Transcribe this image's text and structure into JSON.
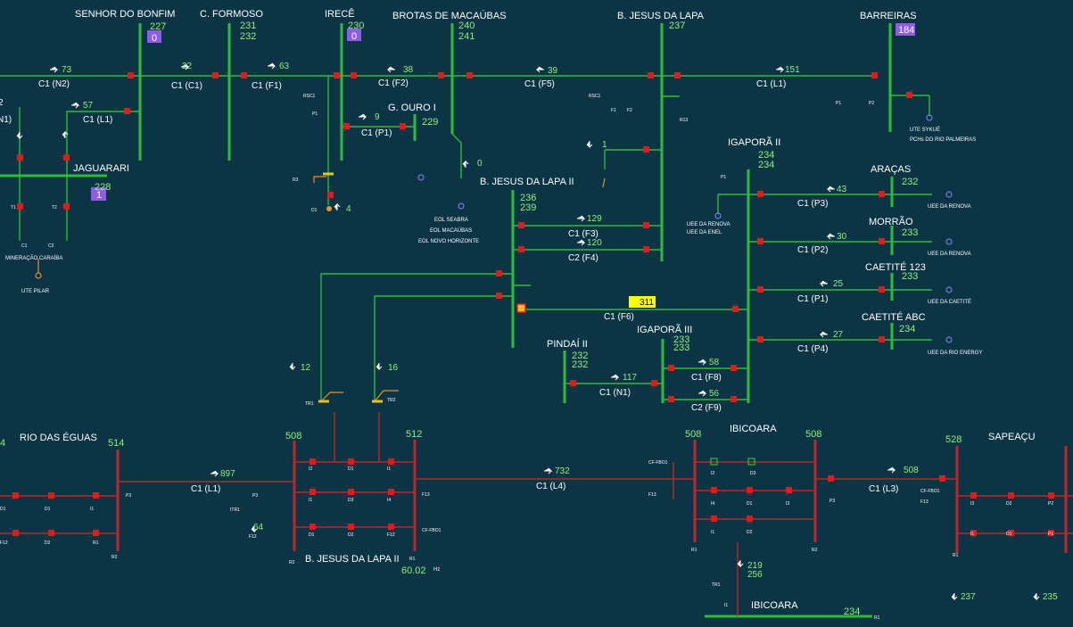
{
  "colors": {
    "background": "#0b3445",
    "bus_230": "#2fbb3a",
    "bus_500": "#c3232a",
    "breaker": "#e01b1b",
    "flow": "#8ff27a",
    "alarm": "#ffff00",
    "tag": "#8f5ce8"
  },
  "substations": {
    "senhor_do_bonfim": {
      "name": "SENHOR DO BONFIM",
      "kv": "227",
      "tag": "0"
    },
    "c_formoso": {
      "name": "C. FORMOSO",
      "kv1": "231",
      "kv2": "232"
    },
    "irece": {
      "name": "IRECÊ",
      "kv": "230",
      "tag": "0"
    },
    "brotas": {
      "name": "BROTAS DE MACAÚBAS",
      "kv1": "240",
      "kv2": "241"
    },
    "bjl": {
      "name": "B. JESUS DA LAPA",
      "kv": "237"
    },
    "barreiras": {
      "name": "BARREIRAS",
      "tag": "184"
    },
    "jaguarari": {
      "name": "JAGUARARI",
      "kv": "228",
      "tag": "1"
    },
    "g_ouro": {
      "name": "G. OURO I",
      "kv": "229"
    },
    "bjl2": {
      "name": "B. JESUS DA LAPA II",
      "kv1": "236",
      "kv2": "239"
    },
    "igapora2": {
      "name": "IGAPORÃ II",
      "kv1": "234",
      "kv2": "234"
    },
    "aracas": {
      "name": "ARAÇAS",
      "kv": "232"
    },
    "morrao": {
      "name": "MORRÃO",
      "kv": "233"
    },
    "caetite123": {
      "name": "CAETITÉ 123",
      "kv": "233"
    },
    "caetiteabc": {
      "name": "CAETITÉ ABC",
      "kv": "234"
    },
    "pindai": {
      "name": "PINDAÍ II",
      "kv1": "232",
      "kv2": "232"
    },
    "igapora3": {
      "name": "IGAPORÃ III",
      "kv1": "233",
      "kv2": "233"
    },
    "rio_das_eguas": {
      "name": "RIO DAS ÉGUAS",
      "kv": "514",
      "kv_left": "4"
    },
    "bjl2_500": {
      "name": "B. JESUS DA LAPA II",
      "kv1": "508",
      "kv2": "512",
      "freq": "60.02",
      "freq_unit": "Hz"
    },
    "ibicoara": {
      "name": "IBICOARA",
      "kv1": "508",
      "kv2": "508"
    },
    "sapeacu": {
      "name": "SAPEAÇU",
      "kv": "528"
    },
    "ibicoara_230": {
      "name": "IBICOARA",
      "kv": "234"
    }
  },
  "lines": {
    "l1": {
      "flow": "73",
      "name": "C1 (N2)"
    },
    "l2": {
      "flow": "22",
      "name": "C1 (C1)"
    },
    "l3": {
      "flow": "63",
      "name": "C1 (F1)"
    },
    "l4": {
      "flow": "38",
      "name": "C1 (F2)"
    },
    "l5": {
      "flow": "39",
      "name": "C1 (F5)"
    },
    "l6": {
      "flow": "151",
      "name": "C1 (L1)"
    },
    "l7": {
      "flow": "57",
      "name": "C1 (L1)"
    },
    "l8": {
      "flow": "9",
      "name": "C1 (P1)"
    },
    "l9": {
      "flow": "129",
      "name": "C1 (F3)"
    },
    "l10": {
      "flow": "120",
      "name": "C2 (F4)"
    },
    "l11": {
      "flow": "311",
      "name": "C1 (F6)"
    },
    "l12": {
      "flow": "43",
      "name": "C1 (P3)"
    },
    "l13": {
      "flow": "30",
      "name": "C1 (P2)"
    },
    "l14": {
      "flow": "25",
      "name": "C1 (P1)"
    },
    "l15": {
      "flow": "27",
      "name": "C1 (P4)"
    },
    "l16": {
      "flow": "117",
      "name": "C1 (N1)"
    },
    "l17": {
      "flow": "58",
      "name": "C1 (F8)"
    },
    "l18": {
      "flow": "56",
      "name": "C2 (F9)"
    },
    "l19": {
      "flow": "897",
      "name": "C1 (L1)"
    },
    "l20": {
      "flow": "732",
      "name": "C1 (L4)"
    },
    "l21": {
      "flow": "508",
      "name": "C1 (L3)"
    }
  },
  "misc": {
    "partial_n1": "N1)",
    "partial_2": "2",
    "gen_brotas_flow": "0",
    "gen_bjl_flow": "1",
    "irece_gen_flow": "4",
    "tr1_flow": "12",
    "tr2_flow": "16",
    "bjl2_cap": "64",
    "ibicoara_tr1": "219",
    "ibicoara_tr2": "256",
    "sapeacu_tr1": "237",
    "sapeacu_tr2": "235"
  },
  "plants": {
    "mineracao": "MINERAÇÃO CARAÍBA",
    "ute_pilar": "UTE PILAR",
    "eol1": "EOL SEABRA",
    "eol2": "EOL MACAÚBAS",
    "eol3": "EOL NOVO HORIZONTE",
    "ute_sykue": "UTE SYKUÉ",
    "pch": "PCHs DO RIO PALMEIRAS",
    "renova1": "UEE DA RENOVA",
    "renova2": "UEE DA ENEL",
    "renova_a": "UEE DA RENOVA",
    "renova_m": "UEE DA RENOVA",
    "caetite": "UEE DA CAETITÉ",
    "rio_energy": "UEE DA RIO ENERGY"
  },
  "devices": [
    "C1",
    "C2",
    "T1",
    "T2",
    "P1",
    "P2",
    "F1",
    "F2",
    "R3",
    "RSC1",
    "D1",
    "D2",
    "D3",
    "I1",
    "I2",
    "I3",
    "I4",
    "R1",
    "R2",
    "F11",
    "F12",
    "F13",
    "P3",
    "CF-FBO1",
    "ITR1",
    "TR1",
    "TR2",
    "R13"
  ]
}
